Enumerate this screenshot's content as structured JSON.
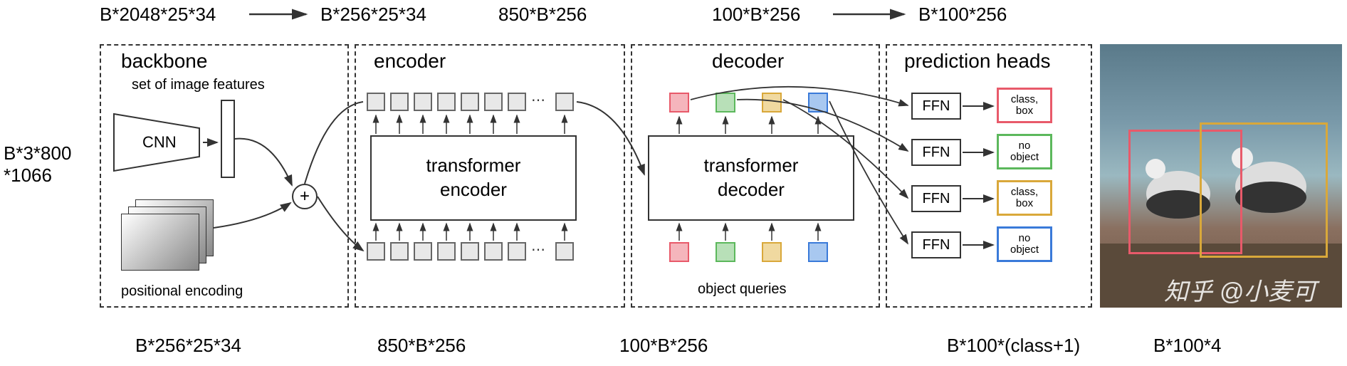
{
  "top_dims": {
    "d1": "B*2048*25*34",
    "d2": "B*256*25*34",
    "d3": "850*B*256",
    "d4": "100*B*256",
    "d5": "B*100*256"
  },
  "left_dim": "B*3*800\n*1066",
  "bottom_dims": {
    "d1": "B*256*25*34",
    "d2": "850*B*256",
    "d3": "100*B*256",
    "d4": "B*100*(class+1)",
    "d5": "B*100*4"
  },
  "modules": {
    "backbone": "backbone",
    "encoder": "encoder",
    "decoder": "decoder",
    "heads": "prediction heads"
  },
  "labels": {
    "set_features": "set of image features",
    "cnn": "CNN",
    "positional": "positional encoding",
    "trans_enc": "transformer\nencoder",
    "trans_dec": "transformer\ndecoder",
    "obj_queries": "object queries",
    "ffn": "FFN",
    "class_box": "class,\nbox",
    "no_object": "no\nobject"
  },
  "colors": {
    "red": "#e85a6a",
    "green": "#5cb85c",
    "orange": "#d9a83a",
    "blue": "#3a7ad9"
  },
  "watermark": "知乎 @小麦可"
}
